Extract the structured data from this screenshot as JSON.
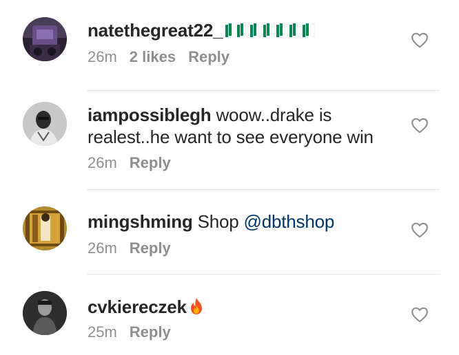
{
  "comments": [
    {
      "username": "natethegreat22_",
      "text": "",
      "emoji": "nigeria-flag-emoji",
      "time": "26m",
      "likes": "2 likes",
      "reply": "Reply"
    },
    {
      "username": "iampossiblegh",
      "text": "woow..drake is realest..he want to see everyone win",
      "time": "26m",
      "reply": "Reply"
    },
    {
      "username": "mingshming",
      "text": "Shop ",
      "mention": "@dbthshop",
      "time": "26m",
      "reply": "Reply"
    },
    {
      "username": "cvkiereczek",
      "text": "",
      "emoji": "fire-emoji",
      "time": "25m",
      "reply": "Reply"
    }
  ],
  "colors": {
    "username": "#262626",
    "meta": "#8e8e8e",
    "mention": "#003569",
    "divider": "#e6e6e6",
    "flag_green": "#008751"
  }
}
